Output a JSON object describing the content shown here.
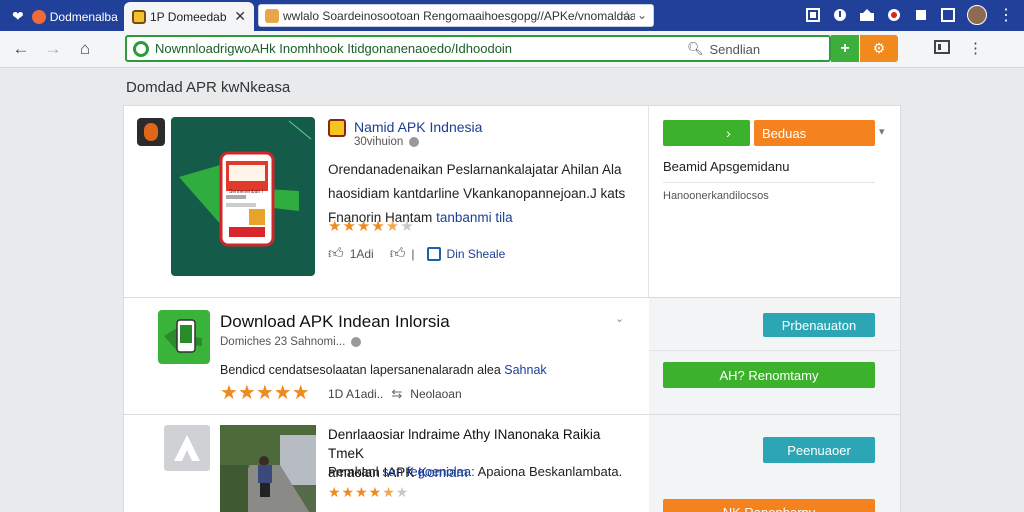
{
  "browser": {
    "tabs": [
      {
        "label": "Dodmenalbas"
      },
      {
        "label": "1P Domeedab"
      },
      {
        "label": "wwlalo Soardeinosootoan Rengomaaihoesgopg//APKe/vnomaldaaa"
      }
    ],
    "address": {
      "url": "NownnloadrigwoAHk Inomhhook Itidgonanenaoedo/Idhoodoin",
      "search_placeholder": "Sendlian"
    },
    "colors": {
      "tabstrip": "#21409a",
      "accent_green": "#3bb12c",
      "accent_orange": "#f4821f",
      "accent_teal": "#2ca6b4",
      "link": "#1c3f93"
    }
  },
  "page": {
    "heading": "Domdad APR kwNkeasa",
    "featured": {
      "title": "Namid APK Indnesia",
      "meta": "30vihuion",
      "description_lines": [
        "Orendanadenaikan Peslarnankalajatar Ahilan Ala",
        "haosidiam kantdarline Vkankanopannejoan.J kats"
      ],
      "description_tail": "Fnanorin Hantam",
      "description_link": "tanbanmi tila",
      "rating": 4.5,
      "likes_label": "1Adi",
      "share_label": "Din Sheale",
      "card_caption": "Sennenenbah Hoesie",
      "sidebar": {
        "download_button": "",
        "secondary_button": "Beduas",
        "title": "Beamid Apsgemidanu",
        "note": "Hanoonerkandilocsos"
      }
    },
    "items": [
      {
        "title": "Download APK Indean Inlorsia",
        "meta": "Domiches 23 Sahnomi...",
        "description": "Bendicd cendatsesolaatan lapersanenalaradn alea",
        "description_link": "Sahnak",
        "rating": 5,
        "count_label": "1D A1adi..",
        "share_label": "Neolaoan",
        "button_primary": "Prbenauaton",
        "button_secondary": "AH? Renomtamy"
      },
      {
        "title_line1": "Denrlaaosiar lndraime Athy INanonaka Raikia TmeK",
        "title_line2": "amaolan IAPK",
        "title_link": "Komiam",
        "description_prefix": "Pemkanl",
        "description_link": "san fegoenolaa:",
        "description_suffix": "Apaiona Beskanlambata.",
        "rating": 4.5,
        "button_primary": "Peenuaoer",
        "button_secondary": "NK Ranonbarny"
      }
    ]
  }
}
